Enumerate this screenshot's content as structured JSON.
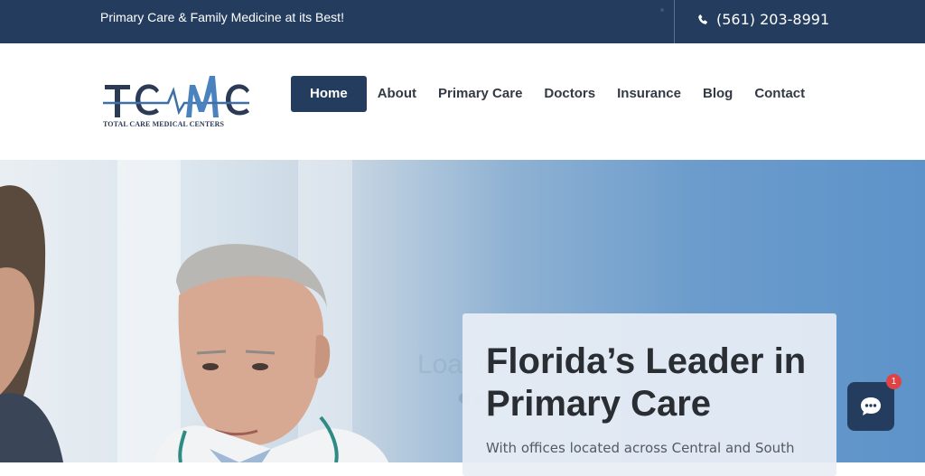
{
  "topbar": {
    "tagline": "Primary Care & Family Medicine at its Best!",
    "phone": "(561) 203-8991",
    "phone_icon": "phone-icon"
  },
  "logo": {
    "mark": "TCMC",
    "subtitle": "TOTAL CARE MEDICAL CENTERS"
  },
  "nav": {
    "items": [
      {
        "label": "Home",
        "active": true
      },
      {
        "label": "About"
      },
      {
        "label": "Primary Care"
      },
      {
        "label": "Doctors"
      },
      {
        "label": "Insurance"
      },
      {
        "label": "Blog"
      },
      {
        "label": "Contact"
      }
    ]
  },
  "hero": {
    "loading_text": "Loading...",
    "title": "Florida’s Leader in Primary Care",
    "text": "With offices located across Central and South"
  },
  "chat": {
    "icon": "chat-bubble-icon",
    "badge": "1"
  },
  "colors": {
    "navy": "#243d5f",
    "badge_red": "#e04343",
    "hero_blue": "#5d93c9"
  }
}
